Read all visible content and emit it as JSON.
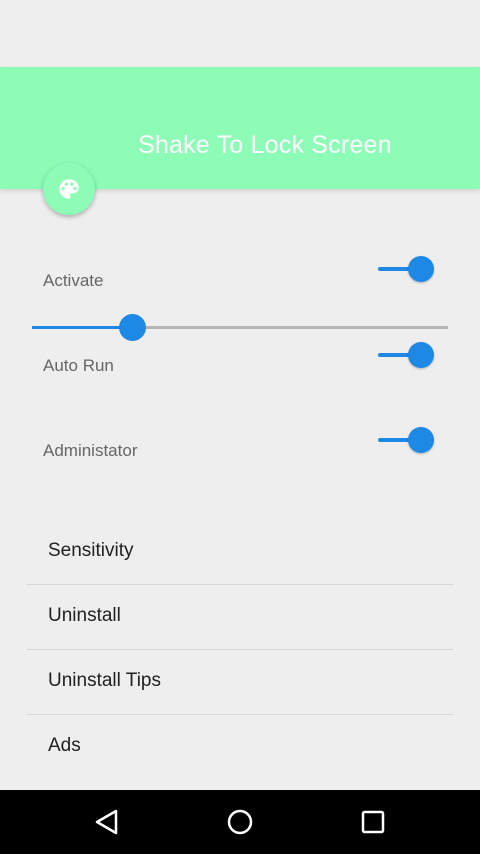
{
  "header": {
    "title": "Shake To Lock Screen",
    "color": "#8cfcb7"
  },
  "fab": {
    "icon": "palette-icon"
  },
  "settings": {
    "activate": {
      "label": "Activate",
      "on": true
    },
    "sensitivity_slider": {
      "value_fraction": 0.24
    },
    "auto_run": {
      "label": "Auto Run",
      "on": true
    },
    "administator": {
      "label": "Administator",
      "on": true
    }
  },
  "menu": {
    "items": [
      {
        "label": "Sensitivity"
      },
      {
        "label": "Uninstall"
      },
      {
        "label": "Uninstall Tips"
      },
      {
        "label": "Ads"
      }
    ]
  },
  "accent_color": "#1e88e5",
  "navbar": {
    "icons": [
      "back-icon",
      "home-icon",
      "recents-icon"
    ]
  }
}
